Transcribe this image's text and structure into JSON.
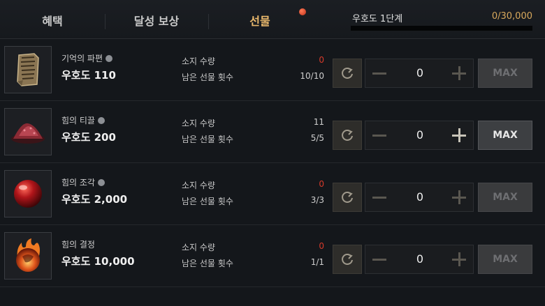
{
  "tabs": [
    {
      "label": "혜택",
      "active": false
    },
    {
      "label": "달성 보상",
      "active": false
    },
    {
      "label": "선물",
      "active": true
    }
  ],
  "stage": {
    "label": "우호도 1단계",
    "count": "0/30,000",
    "progress": 0.0
  },
  "labels": {
    "owned": "소지 수량",
    "remaining": "남은 선물 횟수",
    "max": "MAX"
  },
  "items": [
    {
      "name": "기억의 파편",
      "locked": true,
      "cost": "우호도 110",
      "owned": "0",
      "remaining": "10/10",
      "quantity": "0",
      "icon": "scroll-icon"
    },
    {
      "name": "힘의 티끌",
      "locked": true,
      "cost": "우호도 200",
      "owned": "11",
      "remaining": "5/5",
      "quantity": "0",
      "icon": "dust-icon"
    },
    {
      "name": "힘의 조각",
      "locked": true,
      "cost": "우호도 2,000",
      "owned": "0",
      "remaining": "3/3",
      "quantity": "0",
      "icon": "red-orb-icon"
    },
    {
      "name": "힘의 결정",
      "locked": false,
      "cost": "우호도 10,000",
      "owned": "0",
      "remaining": "1/1",
      "quantity": "0",
      "icon": "fire-orb-icon"
    }
  ],
  "colors": {
    "accent": "#e9b86c",
    "zero": "#d63a2a"
  }
}
